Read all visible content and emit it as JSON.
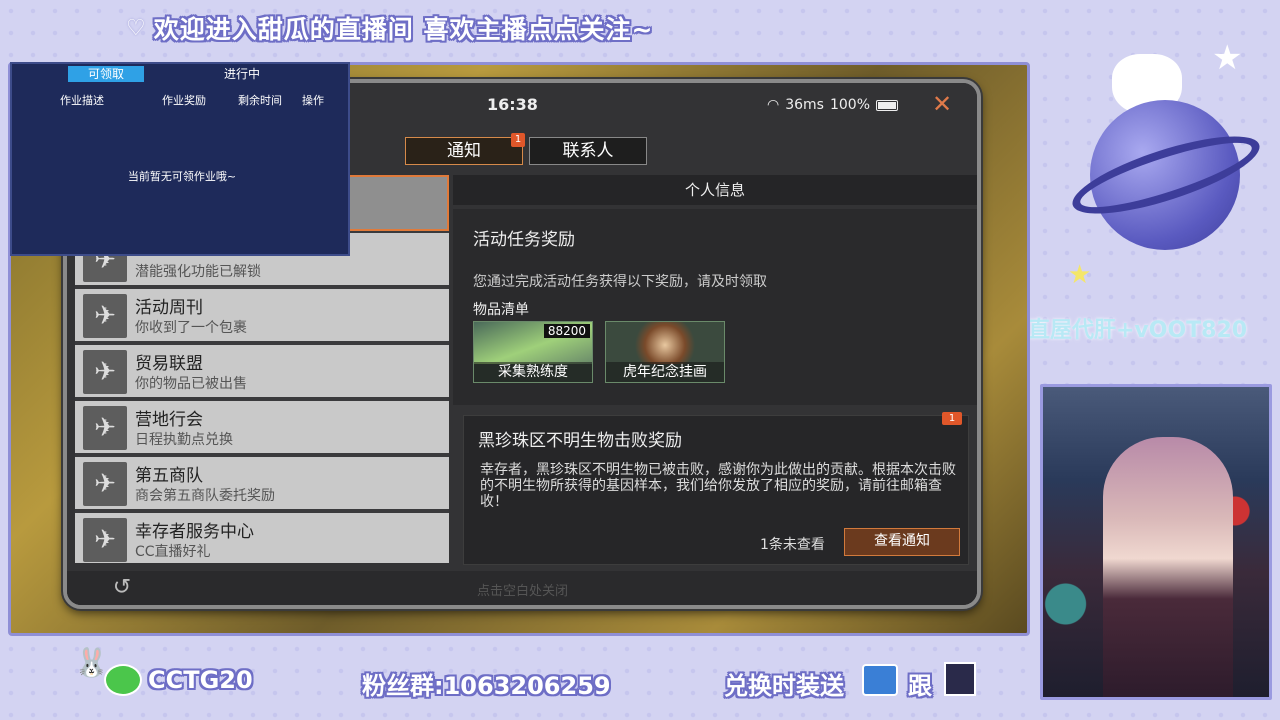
{
  "banner": {
    "text": "欢迎进入甜瓜的直播间 喜欢主播点点关注~"
  },
  "task_overlay": {
    "tabs": [
      {
        "label": "可领取"
      },
      {
        "label": "进行中"
      }
    ],
    "columns": [
      "作业描述",
      "作业奖励",
      "剩余时间",
      "操作"
    ],
    "empty_text": "当前暂无可领作业哦~"
  },
  "game": {
    "status": {
      "clock": "16:38",
      "ping": "36ms",
      "battery": "100%"
    },
    "tabs": {
      "notice": "通知",
      "notice_badge": "1",
      "contacts": "联系人"
    },
    "list": [
      {
        "title": "",
        "sub": "潜能强化功能已解锁"
      },
      {
        "title": "活动周刊",
        "sub": "你收到了一个包裹"
      },
      {
        "title": "贸易联盟",
        "sub": "你的物品已被出售"
      },
      {
        "title": "营地行会",
        "sub": "日程执勤点兑换"
      },
      {
        "title": "第五商队",
        "sub": "商会第五商队委托奖励"
      },
      {
        "title": "幸存者服务中心",
        "sub": "CC直播好礼"
      }
    ],
    "info_header": "个人信息",
    "reward": {
      "title": "活动任务奖励",
      "desc": "您通过完成活动任务获得以下奖励，请及时领取",
      "items_label": "物品清单",
      "items": [
        {
          "name": "采集熟练度",
          "count": "88200"
        },
        {
          "name": "虎年纪念挂画",
          "count": ""
        }
      ]
    },
    "notice": {
      "badge": "1",
      "title": "黑珍珠区不明生物击败奖励",
      "body": "幸存者，黑珍珠区不明生物已被击败，感谢你为此做出的贡献。根据本次击败的不明生物所获得的基因样本，我们给你发放了相应的奖励，请前往邮箱查收！",
      "unread": "1条未查看",
      "view_button": "查看通知"
    },
    "bottom": {
      "tap_close": "点击空白处关闭"
    }
  },
  "side": {
    "promo": "直屋代肝+vOOT820"
  },
  "bottom_bar": {
    "wechat_id": "CCTG20",
    "fans_group": "粉丝群:1063206259",
    "exchange": "兑换时装送",
    "follow": "跟"
  },
  "colors": {
    "accent_orange": "#e07a3a",
    "overlay_blue": "#1e2a5a",
    "frame_purple": "#8f8fd6"
  },
  "icons": [
    "heart-icon",
    "wifi-icon",
    "battery-icon",
    "close-icon",
    "satellite-dish-icon",
    "back-arrow-icon",
    "wechat-icon",
    "star-icon",
    "planet-icon"
  ]
}
